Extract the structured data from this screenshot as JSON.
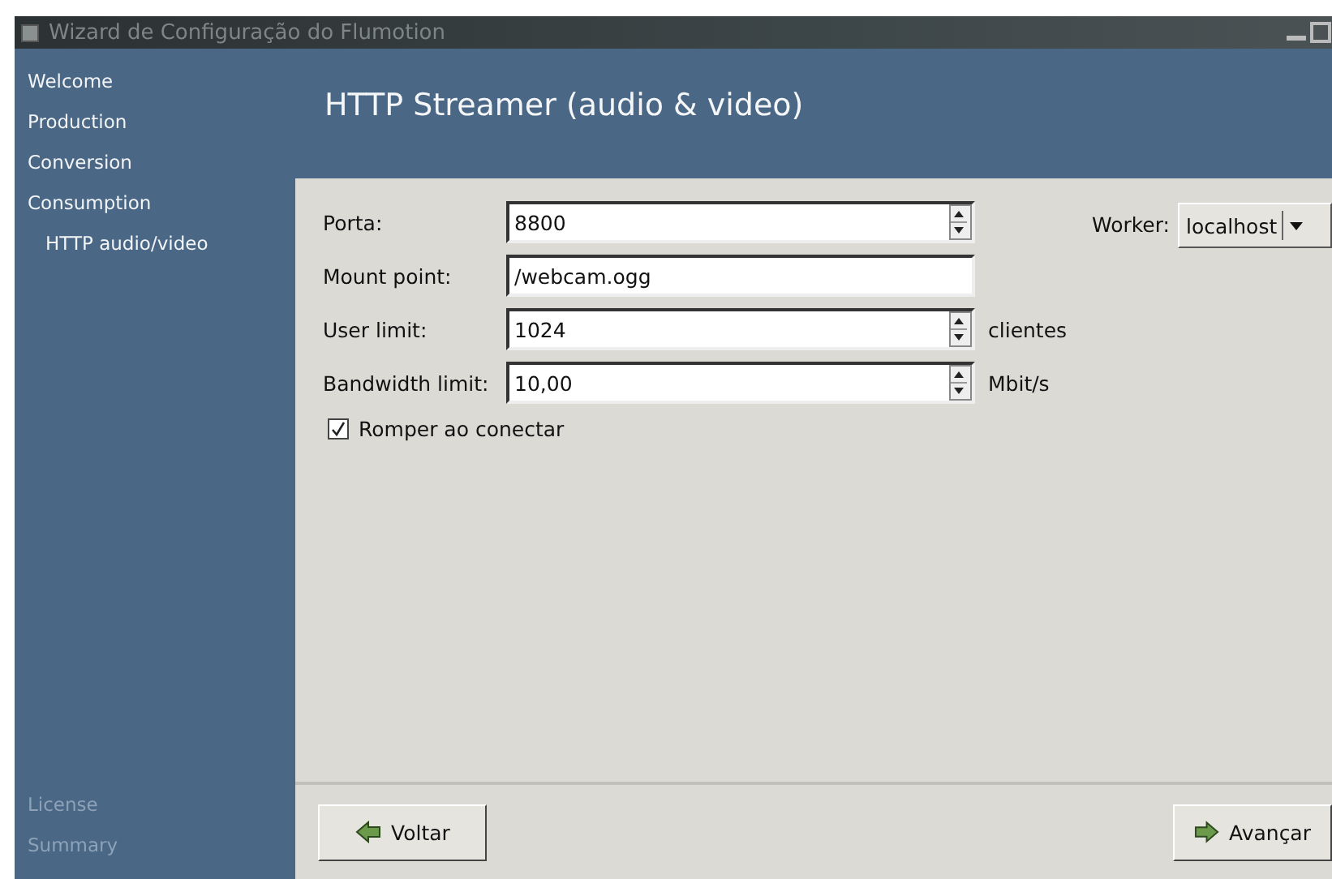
{
  "window": {
    "title": "Wizard de Configuração do Flumotion"
  },
  "sidebar": {
    "items": [
      {
        "label": "Welcome",
        "disabled": false
      },
      {
        "label": "Production",
        "disabled": false
      },
      {
        "label": "Conversion",
        "disabled": false
      },
      {
        "label": "Consumption",
        "disabled": false,
        "children": [
          {
            "label": "HTTP audio/video",
            "disabled": false
          }
        ]
      },
      {
        "label": "License",
        "disabled": true
      },
      {
        "label": "Summary",
        "disabled": true
      }
    ]
  },
  "header": {
    "title": "HTTP Streamer (audio & video)"
  },
  "fields": [
    {
      "kind": "spin",
      "label": "Porta:",
      "value": "8800"
    },
    {
      "kind": "text",
      "label": "Mount point:",
      "value": "/webcam.ogg"
    },
    {
      "kind": "spin",
      "label": "User limit:",
      "value": "1024",
      "unit": "clientes"
    },
    {
      "kind": "spin",
      "label": "Bandwidth limit:",
      "value": "10,00",
      "unit": "Mbit/s"
    }
  ],
  "checkbox": {
    "label": "Romper ao conectar",
    "checked": true
  },
  "worker": {
    "label": "Worker:",
    "value": "localhost"
  },
  "buttons": [
    {
      "label": "Voltar",
      "kind": "back"
    },
    {
      "label": "Avançar",
      "kind": "forward"
    }
  ]
}
